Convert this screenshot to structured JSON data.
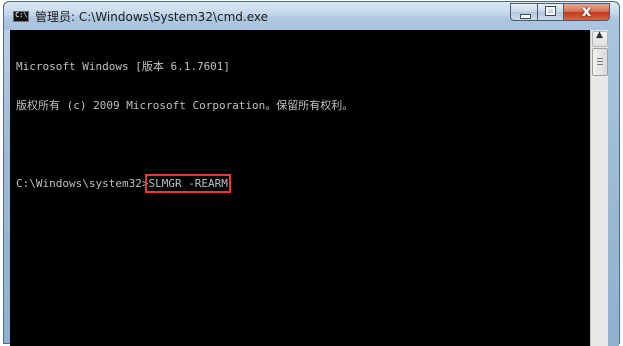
{
  "window": {
    "title": "管理员: C:\\Windows\\System32\\cmd.exe",
    "icon": "cmd-console-icon",
    "icon_text": "C:\\",
    "controls": {
      "minimize": "minimize-icon",
      "maximize": "maximize-icon",
      "close_glyph": "x"
    }
  },
  "console": {
    "lines": [
      "Microsoft Windows [版本 6.1.7601]",
      "版权所有 (c) 2009 Microsoft Corporation。保留所有权利。",
      "",
      "C:\\Windows\\system32>"
    ],
    "typed_command": "SLMGR -REARM",
    "colors": {
      "background": "#000000",
      "text": "#c0c0c0",
      "highlight_box": "#e03a3a"
    }
  },
  "scrollbar": {
    "up_arrow": "▲"
  }
}
